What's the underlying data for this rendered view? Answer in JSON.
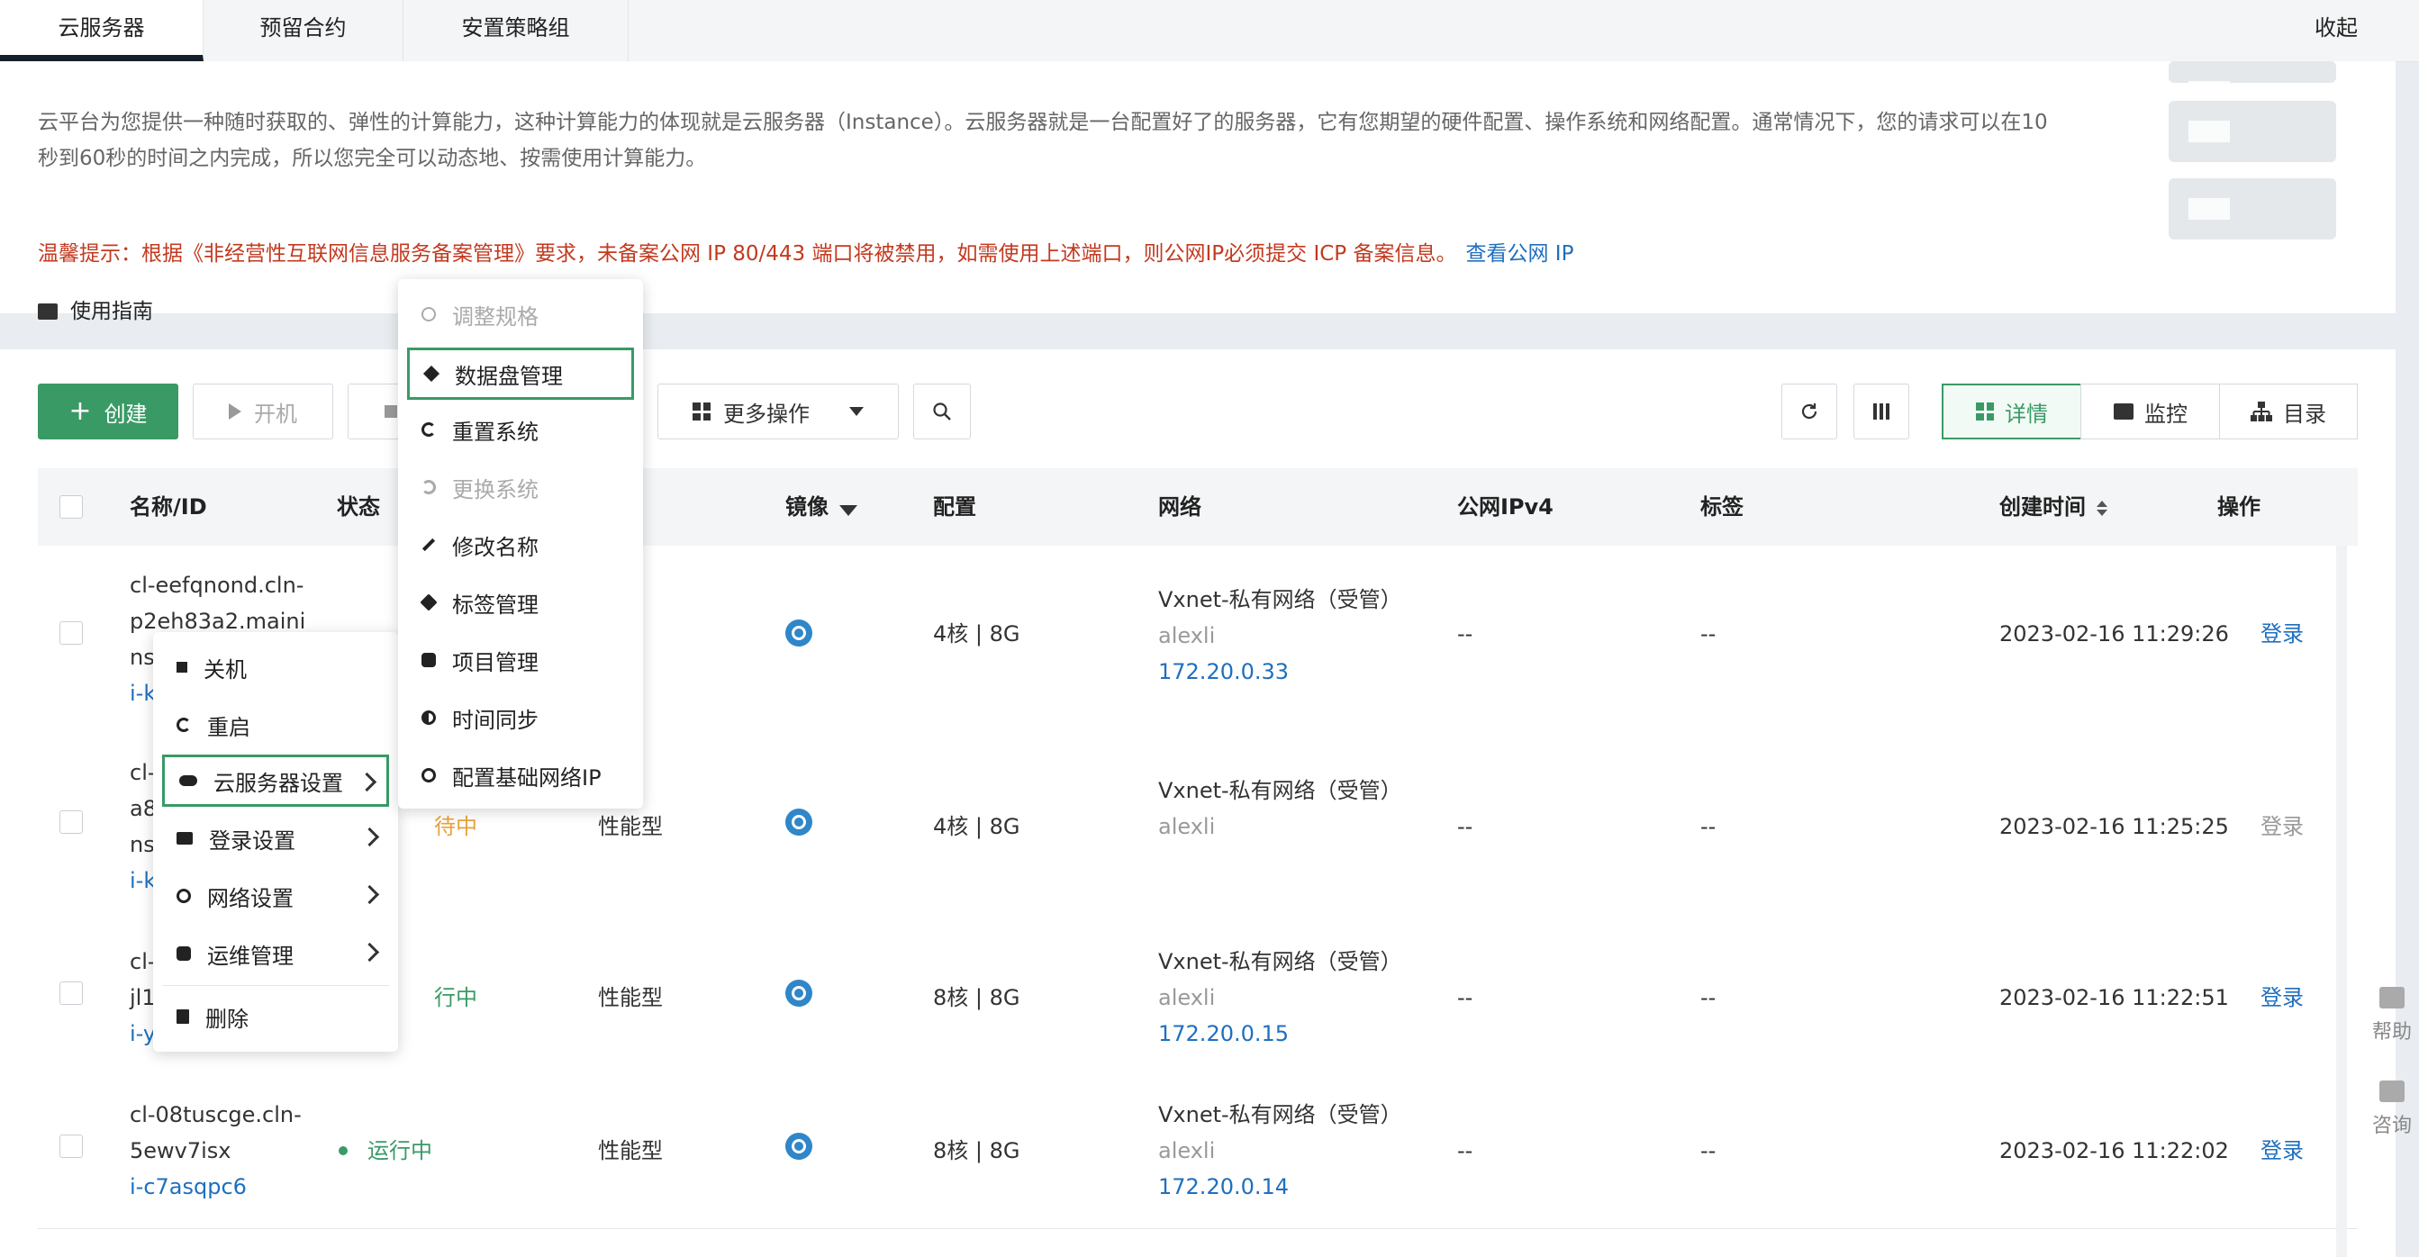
{
  "tabs": [
    "云服务器",
    "预留合约",
    "安置策略组"
  ],
  "collapse_label": "收起",
  "intro": {
    "description": "云平台为您提供一种随时获取的、弹性的计算能力，这种计算能力的体现就是云服务器（Instance）。云服务器就是一台配置好了的服务器，它有您期望的硬件配置、操作系统和网络配置。通常情况下，您的请求可以在10秒到60秒的时间之内完成，所以您完全可以动态地、按需使用计算能力。",
    "notice": "温馨提示：根据《非经营性互联网信息服务备案管理》要求，未备案公网 IP 80/443 端口将被禁用，如需使用上述端口，则公网IP必须提交 ICP 备案信息。",
    "notice_link": "查看公网 IP",
    "guide": "使用指南"
  },
  "toolbar": {
    "create": "创建",
    "start": "开机",
    "more": "更多操作",
    "views": [
      "详情",
      "监控",
      "目录"
    ]
  },
  "table": {
    "headers": [
      "名称/ID",
      "状态",
      "镜像",
      "配置",
      "网络",
      "公网IPv4",
      "标签",
      "创建时间",
      "操作"
    ],
    "rows": [
      {
        "name": [
          "cl-eefqnond.cln-",
          "p2eh83a2.maini",
          "ns"
        ],
        "id": "i-k",
        "status": "",
        "type": "",
        "config": "4核 | 8G",
        "net": "Vxnet-私有网络（受管）",
        "owner": "alexli",
        "ip": "172.20.0.33",
        "ipv4": "--",
        "tag": "--",
        "time": "2023-02-16 11:29:26",
        "op": "登录"
      },
      {
        "name": [
          "cl-",
          "a8",
          "ns"
        ],
        "id": "i-k",
        "status": "待中",
        "type": "性能型",
        "config": "4核 | 8G",
        "net": "Vxnet-私有网络（受管）",
        "owner": "alexli",
        "ip": "",
        "ipv4": "--",
        "tag": "--",
        "time": "2023-02-16 11:25:25",
        "op": "登录"
      },
      {
        "name": [
          "cl-",
          "jl1"
        ],
        "id": "i-y",
        "status": "行中",
        "type": "性能型",
        "config": "8核 | 8G",
        "net": "Vxnet-私有网络（受管）",
        "owner": "alexli",
        "ip": "172.20.0.15",
        "ipv4": "--",
        "tag": "--",
        "time": "2023-02-16 11:22:51",
        "op": "登录"
      },
      {
        "name": [
          "cl-08tuscge.cln-",
          "5ewv7isx"
        ],
        "id": "i-c7asqpc6",
        "status": "运行中",
        "type": "性能型",
        "config": "8核 | 8G",
        "net": "Vxnet-私有网络（受管）",
        "owner": "alexli",
        "ip": "172.20.0.14",
        "ipv4": "--",
        "tag": "--",
        "time": "2023-02-16 11:22:02",
        "op": "登录"
      }
    ]
  },
  "context_menu": [
    "关机",
    "重启",
    "云服务器设置",
    "登录设置",
    "网络设置",
    "运维管理",
    "删除"
  ],
  "submenu": [
    "调整规格",
    "数据盘管理",
    "重置系统",
    "更换系统",
    "修改名称",
    "标签管理",
    "项目管理",
    "时间同步",
    "配置基础网络IP"
  ],
  "side": [
    "帮助",
    "咨询"
  ],
  "colors": {
    "accent": "#3a9a66",
    "link": "#1f6fbf",
    "warning": "#c33a1f"
  }
}
